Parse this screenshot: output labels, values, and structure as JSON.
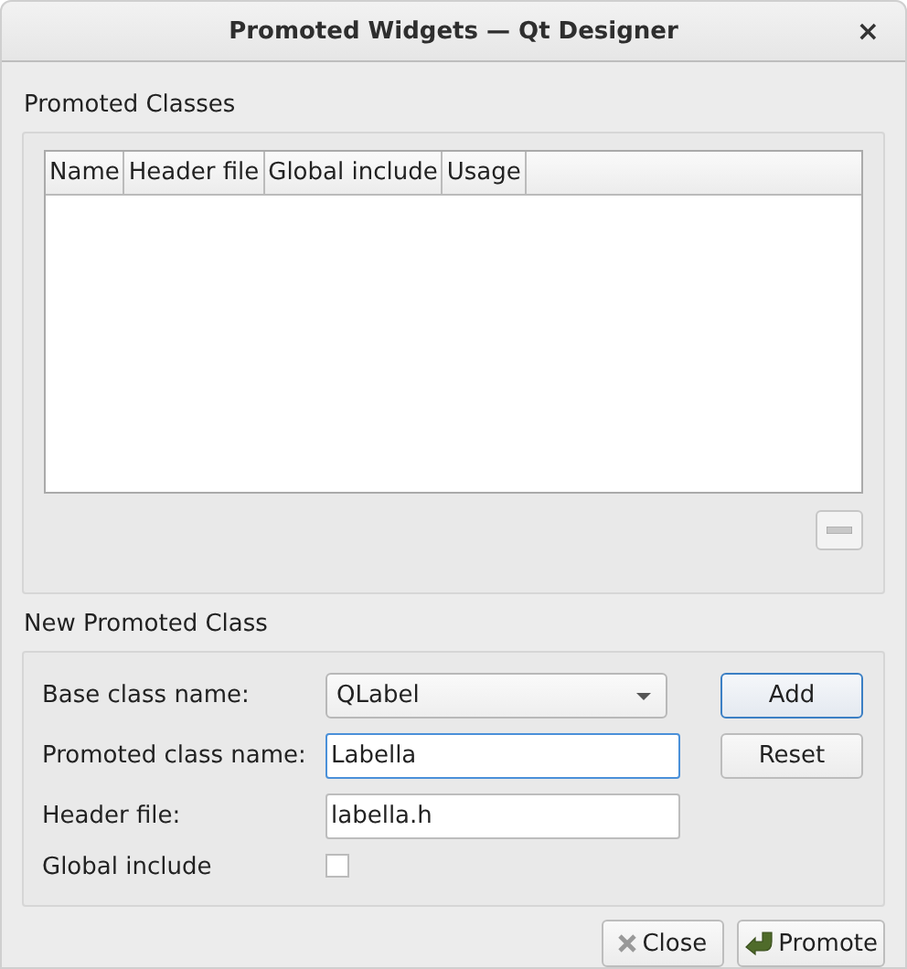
{
  "window": {
    "title": "Promoted Widgets — Qt Designer",
    "close": "×"
  },
  "promoted_classes": {
    "title": "Promoted Classes",
    "columns": [
      "Name",
      "Header file",
      "Global include",
      "Usage"
    ]
  },
  "new_promoted_class": {
    "title": "New Promoted Class",
    "base_class": {
      "label": "Base class name:",
      "value": "QLabel"
    },
    "promoted_class": {
      "label": "Promoted class name:",
      "value": "Labella",
      "focused": true
    },
    "header_file": {
      "label": "Header file:",
      "value": "labella.h",
      "focused": false
    },
    "global_include": {
      "label": "Global include",
      "checked": false
    },
    "buttons": [
      {
        "label": "Add",
        "default": true
      },
      {
        "label": "Reset",
        "default": false
      }
    ]
  },
  "buttons": [
    {
      "label": "Close",
      "kind": "close"
    },
    {
      "label": "Promote",
      "kind": "promote"
    }
  ]
}
